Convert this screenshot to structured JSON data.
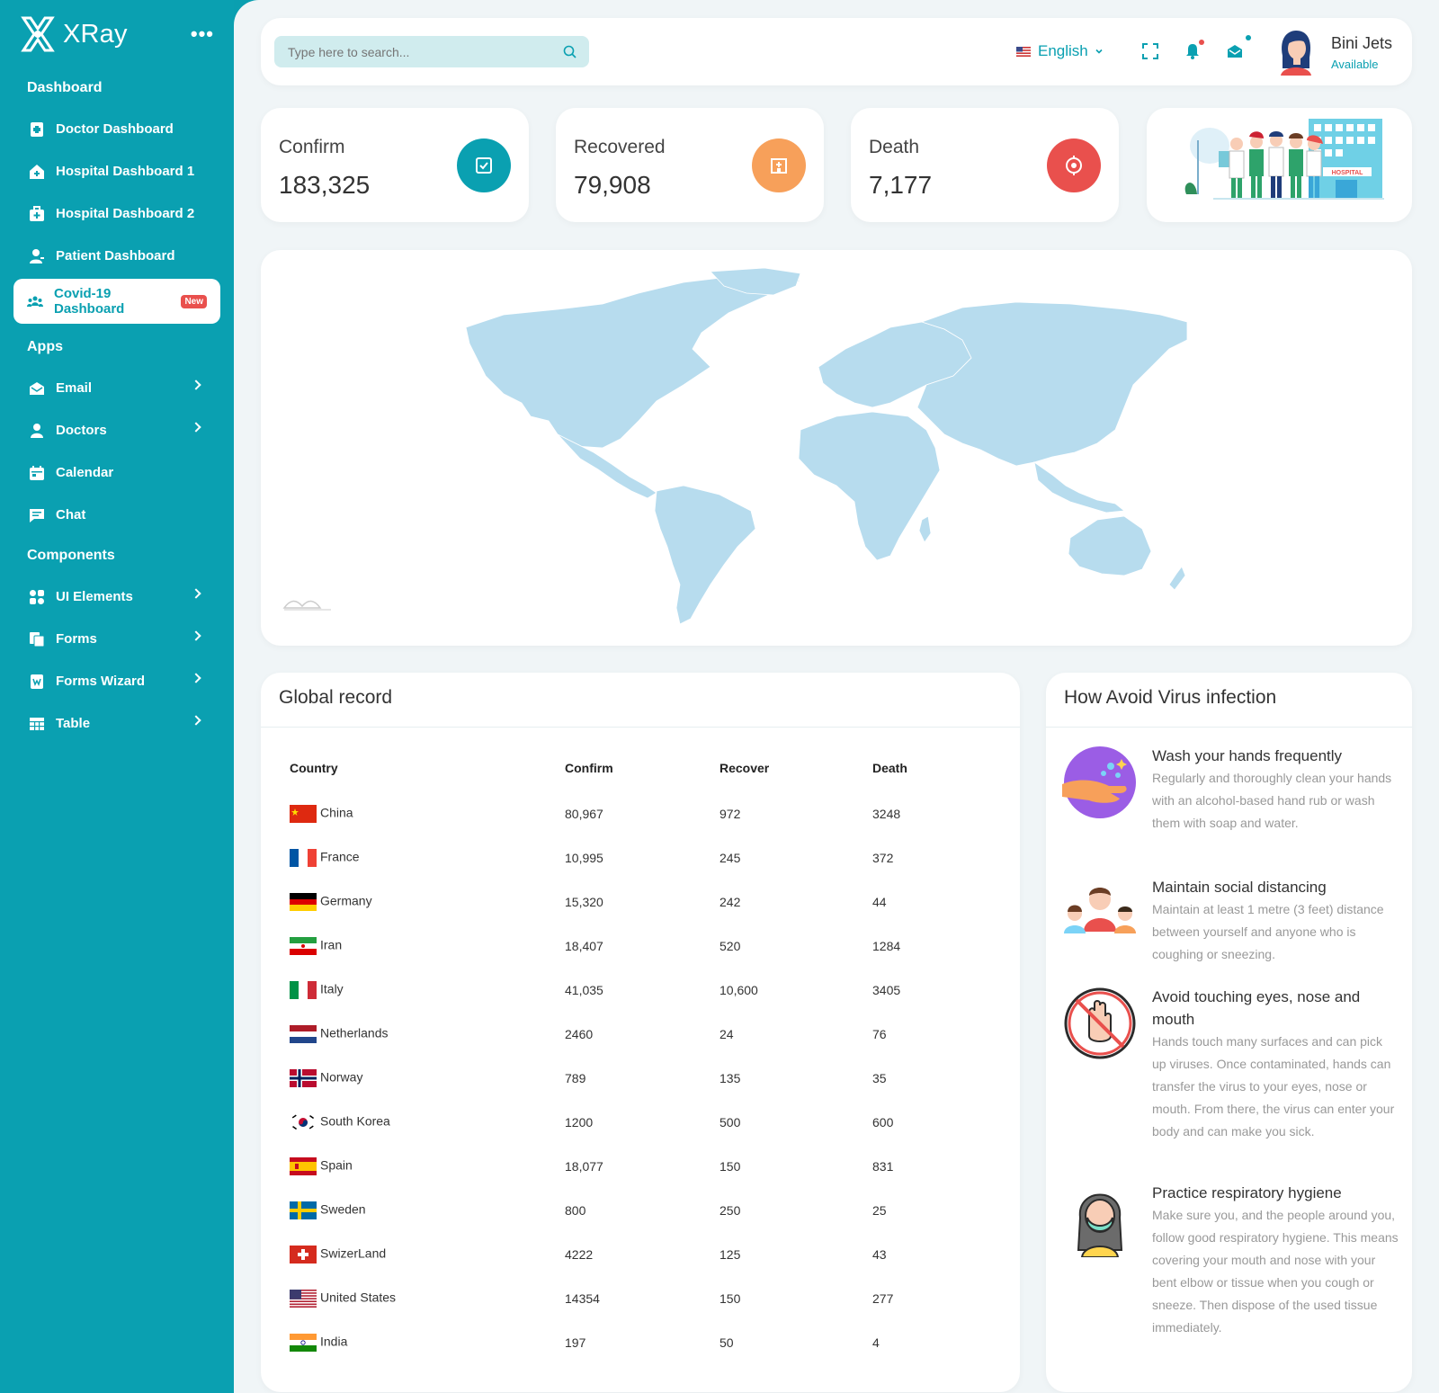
{
  "brand": {
    "name": "XRay"
  },
  "sidebar": {
    "sections": [
      {
        "title": "Dashboard"
      },
      {
        "title": "Apps"
      },
      {
        "title": "Components"
      }
    ],
    "dashboard_items": [
      {
        "label": "Doctor Dashboard",
        "icon": "doctor-icon"
      },
      {
        "label": "Hospital Dashboard 1",
        "icon": "hospital-icon"
      },
      {
        "label": "Hospital Dashboard 2",
        "icon": "medkit-icon"
      },
      {
        "label": "Patient Dashboard",
        "icon": "patient-icon"
      },
      {
        "label": "Covid-19 Dashboard",
        "icon": "people-icon",
        "badge": "New",
        "active": true
      }
    ],
    "app_items": [
      {
        "label": "Email",
        "icon": "email-icon",
        "has_submenu": true
      },
      {
        "label": "Doctors",
        "icon": "user-icon",
        "has_submenu": true
      },
      {
        "label": "Calendar",
        "icon": "calendar-icon",
        "has_submenu": false
      },
      {
        "label": "Chat",
        "icon": "chat-icon",
        "has_submenu": false
      }
    ],
    "component_items": [
      {
        "label": "UI Elements",
        "icon": "grid-icon",
        "has_submenu": true
      },
      {
        "label": "Forms",
        "icon": "forms-icon",
        "has_submenu": true
      },
      {
        "label": "Forms Wizard",
        "icon": "wizard-icon",
        "has_submenu": true
      },
      {
        "label": "Table",
        "icon": "table-icon",
        "has_submenu": true
      }
    ]
  },
  "topbar": {
    "search_placeholder": "Type here to search...",
    "language": "English",
    "user": {
      "name": "Bini Jets",
      "status": "Available"
    }
  },
  "stats": [
    {
      "label": "Confirm",
      "value": "183,325",
      "color": "#0aa0b1",
      "icon": "check-square-icon"
    },
    {
      "label": "Recovered",
      "value": "79,908",
      "color": "#f7a05a",
      "icon": "hospital-building-icon"
    },
    {
      "label": "Death",
      "value": "7,177",
      "color": "#e9504d",
      "icon": "target-icon"
    }
  ],
  "hospital_illustration": {
    "sign": "HOSPITAL"
  },
  "global_record": {
    "title": "Global record",
    "columns": [
      "Country",
      "Confirm",
      "Recover",
      "Death"
    ],
    "rows": [
      {
        "country": "China",
        "flag": "cn",
        "confirm": "80,967",
        "recover": "972",
        "death": "3248"
      },
      {
        "country": "France",
        "flag": "fr",
        "confirm": "10,995",
        "recover": "245",
        "death": "372"
      },
      {
        "country": "Germany",
        "flag": "de",
        "confirm": "15,320",
        "recover": "242",
        "death": "44"
      },
      {
        "country": "Iran",
        "flag": "ir",
        "confirm": "18,407",
        "recover": "520",
        "death": "1284"
      },
      {
        "country": "Italy",
        "flag": "it",
        "confirm": "41,035",
        "recover": "10,600",
        "death": "3405"
      },
      {
        "country": "Netherlands",
        "flag": "nl",
        "confirm": "2460",
        "recover": "24",
        "death": "76"
      },
      {
        "country": "Norway",
        "flag": "no",
        "confirm": "789",
        "recover": "135",
        "death": "35"
      },
      {
        "country": "South Korea",
        "flag": "kr",
        "confirm": "1200",
        "recover": "500",
        "death": "600"
      },
      {
        "country": "Spain",
        "flag": "es",
        "confirm": "18,077",
        "recover": "150",
        "death": "831"
      },
      {
        "country": "Sweden",
        "flag": "se",
        "confirm": "800",
        "recover": "250",
        "death": "25"
      },
      {
        "country": "SwizerLand",
        "flag": "ch",
        "confirm": "4222",
        "recover": "125",
        "death": "43"
      },
      {
        "country": "United States",
        "flag": "us",
        "confirm": "14354",
        "recover": "150",
        "death": "277"
      },
      {
        "country": "India",
        "flag": "in",
        "confirm": "197",
        "recover": "50",
        "death": "4"
      }
    ]
  },
  "avoid": {
    "title": "How Avoid Virus infection",
    "tips": [
      {
        "title": "Wash your hands frequently",
        "body": "Regularly and thoroughly clean your hands with an alcohol-based hand rub or wash them with soap and water.",
        "icon": "hand-wash-icon"
      },
      {
        "title": "Maintain social distancing",
        "body": "Maintain at least 1 metre (3 feet) distance between yourself and anyone who is coughing or sneezing.",
        "icon": "social-distance-icon"
      },
      {
        "title": "Avoid touching eyes, nose and mouth",
        "body": "Hands touch many surfaces and can pick up viruses. Once contaminated, hands can transfer the virus to your eyes, nose or mouth. From there, the virus can enter your body and can make you sick.",
        "icon": "no-touch-icon"
      },
      {
        "title": "Practice respiratory hygiene",
        "body": "Make sure you, and the people around you, follow good respiratory hygiene. This means covering your mouth and nose with your bent elbow or tissue when you cough or sneeze. Then dispose of the used tissue immediately.",
        "icon": "mask-icon"
      }
    ]
  },
  "colors": {
    "primary": "#0aa0b1",
    "background": "#f0f5f7",
    "map_land": "#b7dcee",
    "orange": "#f7a05a",
    "red": "#e9504d"
  }
}
